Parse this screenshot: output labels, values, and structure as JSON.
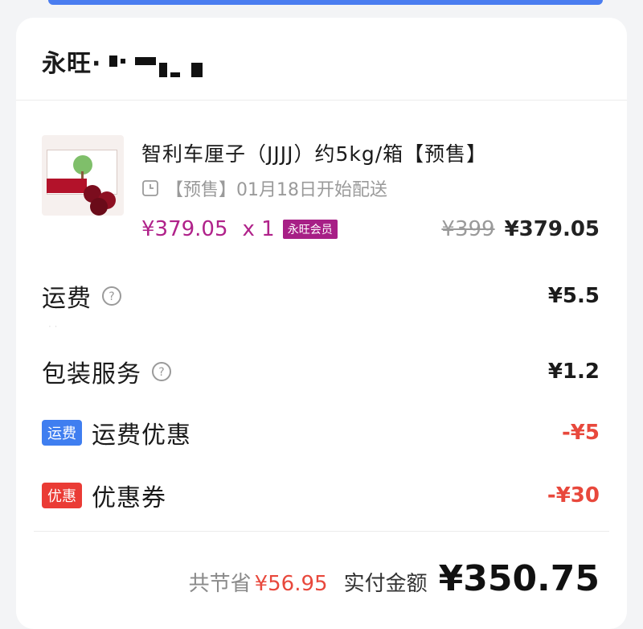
{
  "shop": {
    "name": "永旺·"
  },
  "product": {
    "title": "智利车厘子（JJJJ）约5kg/箱【预售】",
    "presale_note": "【预售】01月18日开始配送",
    "unit_price": "¥379.05",
    "quantity": "x 1",
    "member_badge": "永旺会员",
    "original_price": "¥399",
    "final_price": "¥379.05",
    "image_icon": "cherry-box-image"
  },
  "fees": [
    {
      "label": "运费",
      "value": "¥5.5"
    },
    {
      "label": "包装服务",
      "value": "¥1.2"
    }
  ],
  "discounts": [
    {
      "tag": "运费",
      "label": "运费优惠",
      "value": "-¥5",
      "tag_color": "#3f7ef0"
    },
    {
      "tag": "优惠",
      "label": "优惠券",
      "value": "-¥30",
      "tag_color": "#ea3b35"
    }
  ],
  "summary": {
    "saved_label": "共节省",
    "saved_amount": "¥56.95",
    "pay_label": "实付金额",
    "pay_amount": "¥350.75"
  },
  "colors": {
    "member_purple": "#b0228a",
    "discount_red": "#e8483c",
    "card_bg": "#ffffff",
    "page_bg": "#f3f4f6"
  }
}
